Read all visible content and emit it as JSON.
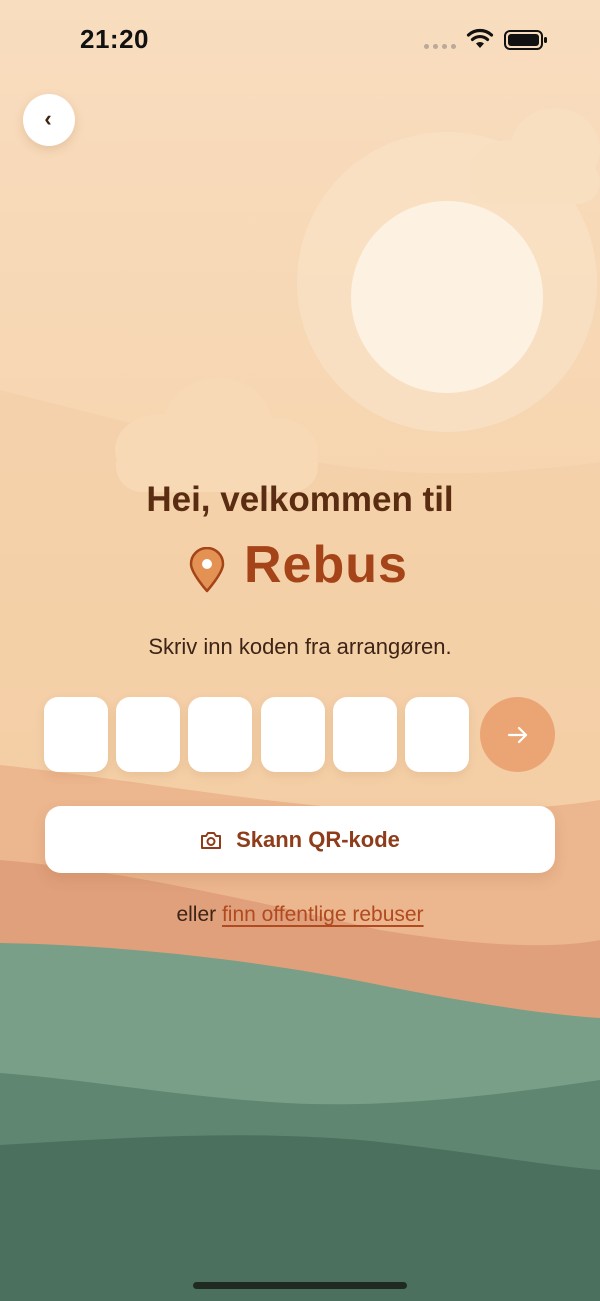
{
  "status_bar": {
    "time": "21:20"
  },
  "back_button": {
    "glyph": "‹",
    "icon": "chevron-left-icon"
  },
  "welcome": {
    "greeting": "Hei, velkommen til",
    "brand_name": "Rebus",
    "brand_icon": "map-pin-icon"
  },
  "code_entry": {
    "instruction": "Skriv inn koden fra arrangøren.",
    "digits": [
      "",
      "",
      "",
      "",
      "",
      ""
    ],
    "submit_icon": "arrow-right-icon"
  },
  "qr_button": {
    "label": "Skann QR-kode",
    "icon": "camera-icon"
  },
  "alternative": {
    "prefix": "eller",
    "link_label": "finn offentlige rebuser"
  },
  "colors": {
    "sky": "#f7dcbb",
    "accent": "#a44418",
    "button_accent": "#eba574",
    "hill_green": "#7a9f88",
    "text_dark": "#5a2d12"
  }
}
